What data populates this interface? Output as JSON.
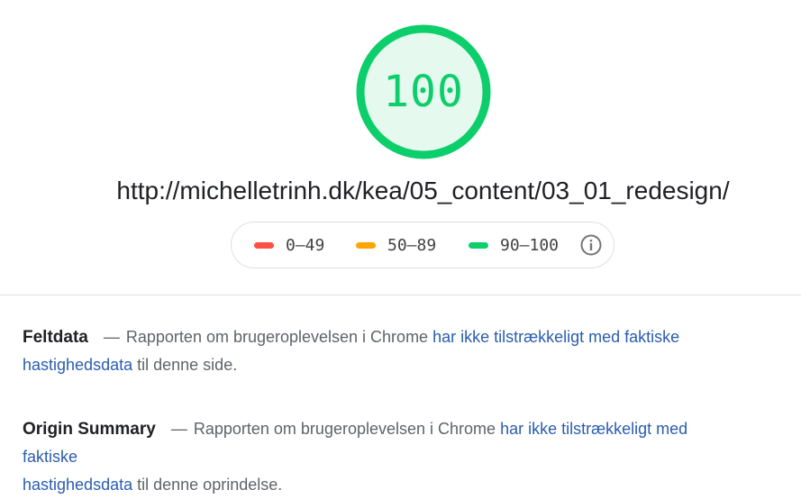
{
  "gauge": {
    "score": "100",
    "fraction": 1.0,
    "color": "#0cce6b",
    "fill_color": "#e6f9ef"
  },
  "url": "http://michelletrinh.dk/kea/05_content/03_01_redesign/",
  "legend": {
    "items": [
      {
        "label": "0–49",
        "color": "#ff4e42"
      },
      {
        "label": "50–89",
        "color": "#ffa400"
      },
      {
        "label": "90–100",
        "color": "#0cce6b"
      }
    ],
    "info_icon": "info-icon"
  },
  "field_data": {
    "title": "Feltdata",
    "dash": "—",
    "text_before": "Rapporten om brugeroplevelsen i Chrome",
    "link_line1": "har ikke tilstrækkeligt med faktiske",
    "link_line2": "hastighedsdata",
    "text_after": "til denne side."
  },
  "origin_summary": {
    "title": "Origin Summary",
    "dash": "—",
    "text_before": "Rapporten om brugeroplevelsen i Chrome",
    "link_line1": "har ikke tilstrækkeligt med faktiske",
    "link_line2": "hastighedsdata",
    "text_after": "til denne oprindelse."
  }
}
